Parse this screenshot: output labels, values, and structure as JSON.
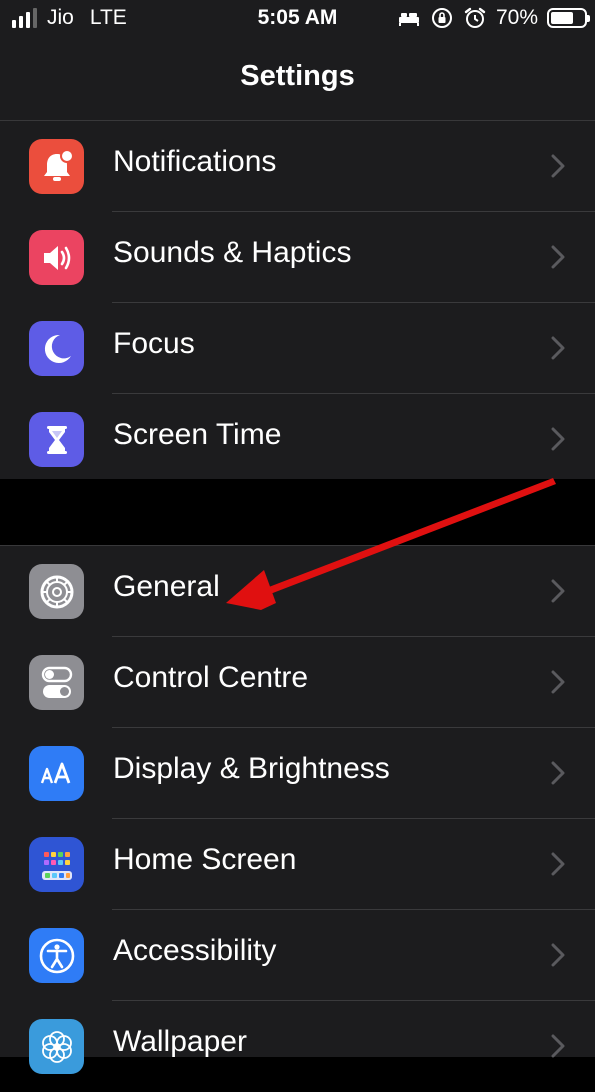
{
  "status_bar": {
    "carrier": "Jio",
    "network": "LTE",
    "time": "5:05 AM",
    "battery_percent": "70%",
    "battery_level": 0.7,
    "icons": [
      "signal-icon",
      "bed-icon",
      "orientation-lock-icon",
      "alarm-icon",
      "battery-icon"
    ]
  },
  "nav": {
    "title": "Settings"
  },
  "groups": [
    {
      "items": [
        {
          "label": "Notifications",
          "icon": "notifications-bell-icon",
          "color": "#eb4e3d"
        },
        {
          "label": "Sounds & Haptics",
          "icon": "speaker-icon",
          "color": "#eb4461"
        },
        {
          "label": "Focus",
          "icon": "moon-icon",
          "color": "#5e5ce6"
        },
        {
          "label": "Screen Time",
          "icon": "hourglass-icon",
          "color": "#5e5ce6"
        }
      ]
    },
    {
      "items": [
        {
          "label": "General",
          "icon": "gear-icon",
          "color": "#8e8e93"
        },
        {
          "label": "Control Centre",
          "icon": "toggles-icon",
          "color": "#8e8e93"
        },
        {
          "label": "Display & Brightness",
          "icon": "text-size-icon",
          "color": "#2f7cf6"
        },
        {
          "label": "Home Screen",
          "icon": "home-screen-grid-icon",
          "color": "#2f55d4"
        },
        {
          "label": "Accessibility",
          "icon": "accessibility-icon",
          "color": "#2f7cf6"
        },
        {
          "label": "Wallpaper",
          "icon": "flower-icon",
          "color": "#3a9bdc"
        }
      ]
    }
  ],
  "annotation": {
    "type": "red-arrow",
    "points_to": "General",
    "color": "#e01010"
  }
}
